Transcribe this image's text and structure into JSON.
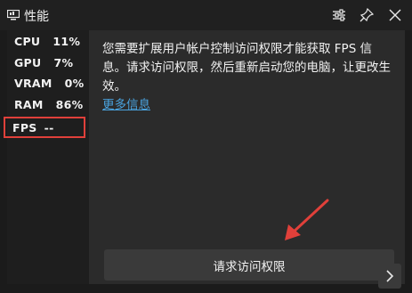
{
  "window": {
    "title": "性能"
  },
  "metrics": [
    {
      "label": "CPU",
      "value": "11%"
    },
    {
      "label": "GPU",
      "value": "7%"
    },
    {
      "label": "VRAM",
      "value": "0%"
    },
    {
      "label": "RAM",
      "value": "86%"
    },
    {
      "label": "FPS",
      "value": "--"
    }
  ],
  "content": {
    "message": "您需要扩展用户帐户控制访问权限才能获取 FPS 信息。请求访问权限，然后重新启动您的电脑，让更改生效。",
    "more_info_link": "更多信息",
    "request_button": "请求访问权限"
  },
  "colors": {
    "background": "#1b1b1b",
    "panel": "#2b2b2b",
    "link": "#4aa3df",
    "highlight_border": "#e0403a",
    "annotation_arrow": "#e0403a"
  },
  "icons": {
    "app": "performance-monitor-icon",
    "settings": "sliders-icon",
    "pin": "pin-icon",
    "close": "close-icon",
    "next": "chevron-right-icon"
  }
}
